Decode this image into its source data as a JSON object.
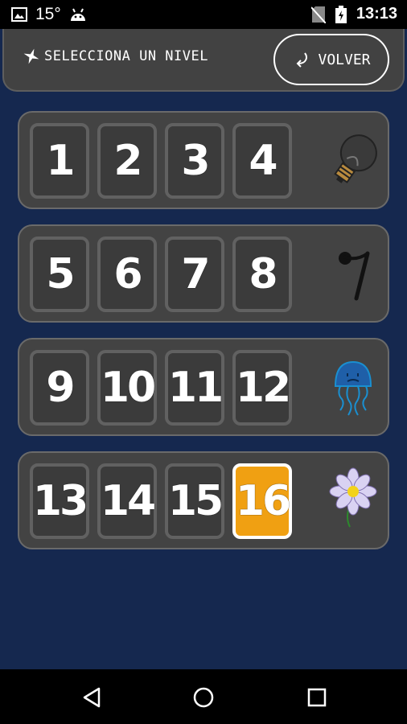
{
  "status_bar": {
    "temperature": "15°",
    "time": "13:13",
    "left_icons": [
      "image-icon",
      "android-icon"
    ],
    "right_icons": [
      "no-sim-icon",
      "battery-charging-icon"
    ]
  },
  "header": {
    "title": "SELECCIONA UN NIVEL",
    "back_label": "VOLVER"
  },
  "rows": [
    {
      "levels": [
        "1",
        "2",
        "3",
        "4"
      ],
      "icon": "lightbulb-icon"
    },
    {
      "levels": [
        "5",
        "6",
        "7",
        "8"
      ],
      "icon": "music-rest-icon"
    },
    {
      "levels": [
        "9",
        "10",
        "11",
        "12"
      ],
      "icon": "jellyfish-icon"
    },
    {
      "levels": [
        "13",
        "14",
        "15",
        "16"
      ],
      "icon": "flower-icon"
    }
  ],
  "current_level": "16",
  "colors": {
    "background": "#15284f",
    "panel": "#434343",
    "current_level": "#f0a012"
  },
  "nav_bar": [
    "back-nav-icon",
    "home-nav-icon",
    "recents-nav-icon"
  ]
}
